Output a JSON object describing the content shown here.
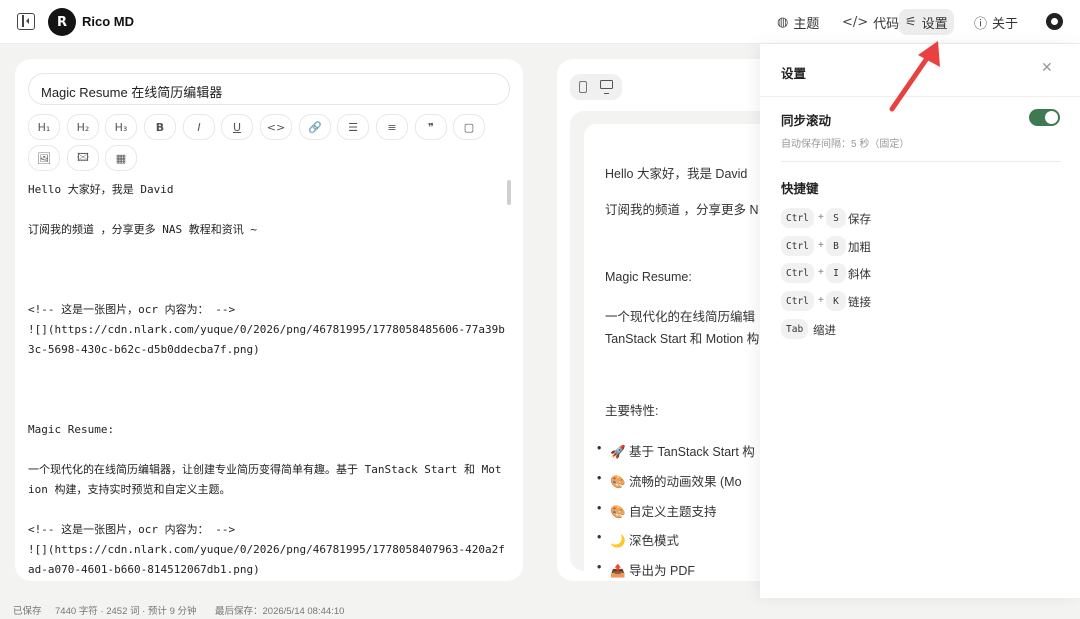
{
  "header": {
    "logo_text": "R",
    "app_title": "Rico MD",
    "nav": [
      {
        "label": "主题",
        "icon": "palette-icon",
        "glyph": "⚙"
      },
      {
        "label": "代码",
        "icon": "code-icon",
        "glyph": "</>"
      },
      {
        "label": "设置",
        "icon": "sliders-icon",
        "glyph": "⚟"
      },
      {
        "label": "关于",
        "icon": "info-icon",
        "glyph": "ⓘ"
      }
    ]
  },
  "editor": {
    "doc_title": "Magic Resume 在线简历编辑器",
    "toolbar_row1": [
      "H₁",
      "H₂",
      "H₃",
      "B",
      "I",
      "U",
      "<>",
      "🔗",
      "☰",
      "≡",
      "❞",
      "▢"
    ],
    "toolbar_row2": [
      "🖼",
      "🖾",
      "▦"
    ],
    "content": "Hello 大家好，我是 David\n\n订阅我的频道 ，分享更多 NAS 教程和资讯 ~\n\n\n\n<!-- 这是一张图片，ocr 内容为： -->\n![](https://cdn.nlark.com/yuque/0/2026/png/46781995/1778058485606-77a39b3c-5698-430c-b62c-d5b0ddecba7f.png)\n\n\n\nMagic Resume:\n\n一个现代化的在线简历编辑器，让创建专业简历变得简单有趣。基于 TanStack Start 和 Motion 构建，支持实时预览和自定义主题。\n\n<!-- 这是一张图片，ocr 内容为： -->\n![](https://cdn.nlark.com/yuque/0/2026/png/46781995/1778058407963-420a2fad-a070-4601-b660-814512067db1.png)"
  },
  "preview": {
    "lines": [
      "Hello 大家好，我是 David",
      "订阅我的频道 ，分享更多 N",
      "Magic Resume:",
      "一个现代化的在线简历编辑",
      "TanStack Start 和 Motion 构",
      "主要特性:"
    ],
    "bullets": [
      "🚀 基于 TanStack Start 构",
      "🎨 流畅的动画效果 (Mo",
      "🎨 自定义主题支持",
      "🌙 深色模式",
      "📤 导出为 PDF"
    ]
  },
  "settings": {
    "title": "设置",
    "sync_scroll_label": "同步滚动",
    "sync_scroll_on": true,
    "autosave_note": "自动保存间隔：5 秒（固定）",
    "shortcuts_title": "快捷键",
    "shortcuts": [
      {
        "keys": [
          "Ctrl",
          "S"
        ],
        "label": "保存"
      },
      {
        "keys": [
          "Ctrl",
          "B"
        ],
        "label": "加粗"
      },
      {
        "keys": [
          "Ctrl",
          "I"
        ],
        "label": "斜体"
      },
      {
        "keys": [
          "Ctrl",
          "K"
        ],
        "label": "链接"
      },
      {
        "keys": [
          "Tab"
        ],
        "label": "缩进"
      }
    ]
  },
  "status_bar": {
    "saved": "已保存",
    "stats": "7440 字符 · 2452 词 · 预计 9 分钟",
    "last_saved": "最后保存：2026/5/14 08:44:10"
  },
  "colors": {
    "accent_green": "#3d7a52",
    "annotation_arrow": "#e8413f"
  }
}
